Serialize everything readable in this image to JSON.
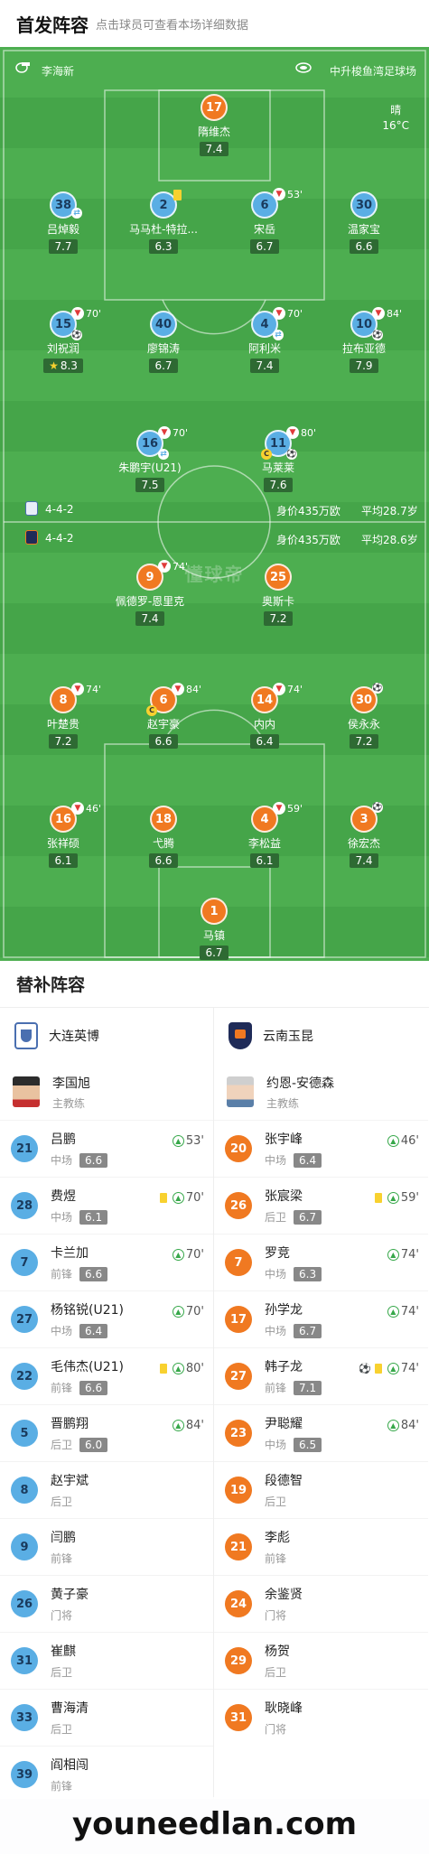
{
  "header": {
    "title": "首发阵容",
    "subtitle": "点击球员可查看本场详细数据"
  },
  "pitch": {
    "referee": "李海新",
    "stadium": "中升梭鱼湾足球场",
    "weather": "晴",
    "temperature": "16°C",
    "watermark": "懂球帝",
    "home_formation": {
      "formation": "4-4-2",
      "value": "身价435万欧",
      "avg_age": "平均28.7岁"
    },
    "away_formation": {
      "formation": "4-4-2",
      "value": "身价435万欧",
      "avg_age": "平均28.6岁"
    }
  },
  "home_players": [
    {
      "number": "17",
      "name": "隋维杰",
      "rating": "7.4"
    },
    {
      "number": "38",
      "name": "吕焯毅",
      "rating": "7.7"
    },
    {
      "number": "2",
      "name": "马马杜-特拉...",
      "rating": "6.3"
    },
    {
      "number": "6",
      "name": "宋岳",
      "rating": "6.7",
      "sub_minute": "53'"
    },
    {
      "number": "30",
      "name": "温家宝",
      "rating": "6.6"
    },
    {
      "number": "15",
      "name": "刘祝润",
      "rating": "8.3",
      "sub_minute": "70'"
    },
    {
      "number": "40",
      "name": "廖锦涛",
      "rating": "6.7"
    },
    {
      "number": "4",
      "name": "阿利米",
      "rating": "7.4",
      "sub_minute": "70'"
    },
    {
      "number": "10",
      "name": "拉布亚德",
      "rating": "7.9",
      "sub_minute": "84'"
    },
    {
      "number": "16",
      "name": "朱鹏宇(U21)",
      "rating": "7.5",
      "sub_minute": "70'"
    },
    {
      "number": "11",
      "name": "马莱莱",
      "rating": "7.6",
      "sub_minute": "80'"
    }
  ],
  "away_players": [
    {
      "number": "9",
      "name": "佩德罗-恩里克",
      "rating": "7.4",
      "sub_minute": "74'"
    },
    {
      "number": "25",
      "name": "奥斯卡",
      "rating": "7.2"
    },
    {
      "number": "8",
      "name": "叶楚贵",
      "rating": "7.2",
      "sub_minute": "74'"
    },
    {
      "number": "6",
      "name": "赵宇豪",
      "rating": "6.6",
      "sub_minute": "84'"
    },
    {
      "number": "14",
      "name": "内内",
      "rating": "6.4",
      "sub_minute": "74'"
    },
    {
      "number": "30",
      "name": "侯永永",
      "rating": "7.2"
    },
    {
      "number": "16",
      "name": "张祥硕",
      "rating": "6.1",
      "sub_minute": "46'"
    },
    {
      "number": "18",
      "name": "弋腾",
      "rating": "6.6"
    },
    {
      "number": "4",
      "name": "李松益",
      "rating": "6.1",
      "sub_minute": "59'"
    },
    {
      "number": "3",
      "name": "徐宏杰",
      "rating": "7.4"
    },
    {
      "number": "1",
      "name": "马镇",
      "rating": "6.7"
    }
  ],
  "subs": {
    "title": "替补阵容",
    "home": {
      "team": "大连英博",
      "coach": {
        "name": "李国旭",
        "role": "主教练"
      },
      "players": [
        {
          "number": "21",
          "name": "吕鹏",
          "position": "中场",
          "rating": "6.6",
          "minute": "53'"
        },
        {
          "number": "28",
          "name": "费煜",
          "position": "中场",
          "rating": "6.1",
          "minute": "70'",
          "yellow": true
        },
        {
          "number": "7",
          "name": "卡兰加",
          "position": "前锋",
          "rating": "6.6",
          "minute": "70'"
        },
        {
          "number": "27",
          "name": "杨铭锐(U21)",
          "position": "中场",
          "rating": "6.4",
          "minute": "70'"
        },
        {
          "number": "22",
          "name": "毛伟杰(U21)",
          "position": "前锋",
          "rating": "6.6",
          "minute": "80'",
          "yellow": true
        },
        {
          "number": "5",
          "name": "晋鹏翔",
          "position": "后卫",
          "rating": "6.0",
          "minute": "84'"
        },
        {
          "number": "8",
          "name": "赵宇斌",
          "position": "后卫"
        },
        {
          "number": "9",
          "name": "闫鹏",
          "position": "前锋"
        },
        {
          "number": "26",
          "name": "黄子豪",
          "position": "门将"
        },
        {
          "number": "31",
          "name": "崔麒",
          "position": "后卫"
        },
        {
          "number": "33",
          "name": "曹海清",
          "position": "后卫"
        },
        {
          "number": "39",
          "name": "阎相闯",
          "position": "前锋"
        }
      ]
    },
    "away": {
      "team": "云南玉昆",
      "coach": {
        "name": "约恩-安德森",
        "role": "主教练"
      },
      "players": [
        {
          "number": "20",
          "name": "张宇峰",
          "position": "中场",
          "rating": "6.4",
          "minute": "46'"
        },
        {
          "number": "26",
          "name": "张宸梁",
          "position": "后卫",
          "rating": "6.7",
          "minute": "59'",
          "yellow": true
        },
        {
          "number": "7",
          "name": "罗竞",
          "position": "中场",
          "rating": "6.3",
          "minute": "74'"
        },
        {
          "number": "17",
          "name": "孙学龙",
          "position": "中场",
          "rating": "6.7",
          "minute": "74'"
        },
        {
          "number": "27",
          "name": "韩子龙",
          "position": "前锋",
          "rating": "7.1",
          "minute": "74'",
          "yellow": true,
          "goal": true
        },
        {
          "number": "23",
          "name": "尹聪耀",
          "position": "中场",
          "rating": "6.5",
          "minute": "84'"
        },
        {
          "number": "19",
          "name": "段德智",
          "position": "后卫"
        },
        {
          "number": "21",
          "name": "李彪",
          "position": "前锋"
        },
        {
          "number": "24",
          "name": "余鉴贤",
          "position": "门将"
        },
        {
          "number": "29",
          "name": "杨贺",
          "position": "后卫"
        },
        {
          "number": "31",
          "name": "耿晓峰",
          "position": "门将"
        }
      ]
    }
  },
  "watermark_footer": "youneedlan.com"
}
